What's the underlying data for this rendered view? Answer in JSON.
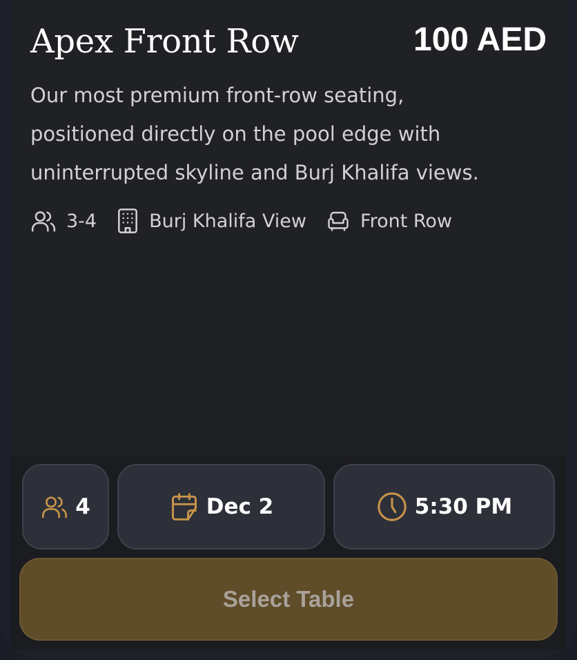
{
  "table": {
    "name": "Apex Front Row",
    "price": "100 AED",
    "description": "Our most premium front-row seating, positioned directly on the pool edge with uninterrupted skyline and Burj Khalifa views.",
    "features": [
      {
        "icon": "users-icon",
        "label": "3-4"
      },
      {
        "icon": "building-icon",
        "label": "Burj Khalifa View"
      },
      {
        "icon": "sofa-icon",
        "label": "Front Row"
      }
    ]
  },
  "booking": {
    "guests": {
      "icon": "users-icon",
      "value": "4"
    },
    "date": {
      "icon": "calendar-icon",
      "value": "Dec 2"
    },
    "time": {
      "icon": "clock-icon",
      "value": "5:30 PM"
    },
    "select_label": "Select Table"
  },
  "colors": {
    "accent": "#c9954a",
    "card_bg": "#202124",
    "pill_bg": "#2d3039",
    "button_bg": "#5f4c29"
  }
}
